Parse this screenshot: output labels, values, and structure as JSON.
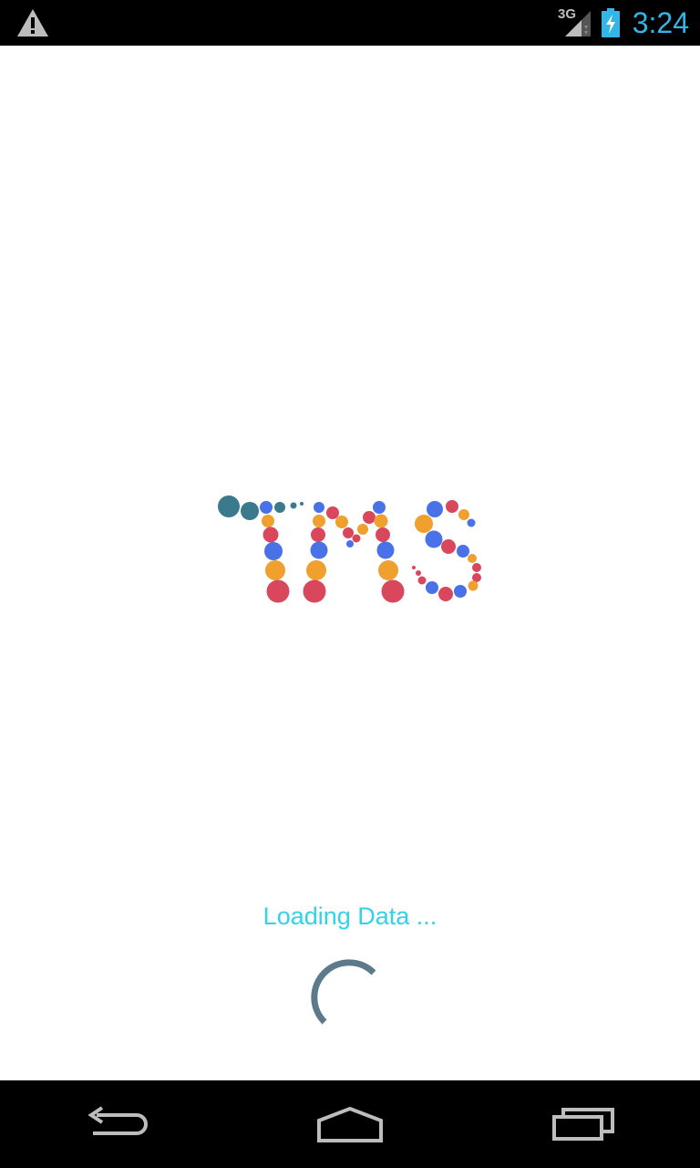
{
  "status_bar": {
    "network_type": "3G",
    "time": "3:24",
    "icons": [
      "warning-icon",
      "signal-icon",
      "battery-charging-icon"
    ]
  },
  "logo": {
    "text": "TMS",
    "colors": {
      "teal": "#3b7a8c",
      "blue": "#4a72e8",
      "red": "#d9475d",
      "orange": "#f0a02e"
    }
  },
  "loading": {
    "text": "Loading Data ..."
  },
  "colors": {
    "accent": "#33b5e5",
    "loading_text": "#2fd3ec",
    "spinner": "#5c7a8c"
  },
  "nav_bar": {
    "buttons": [
      "back-icon",
      "home-icon",
      "recents-icon"
    ]
  }
}
